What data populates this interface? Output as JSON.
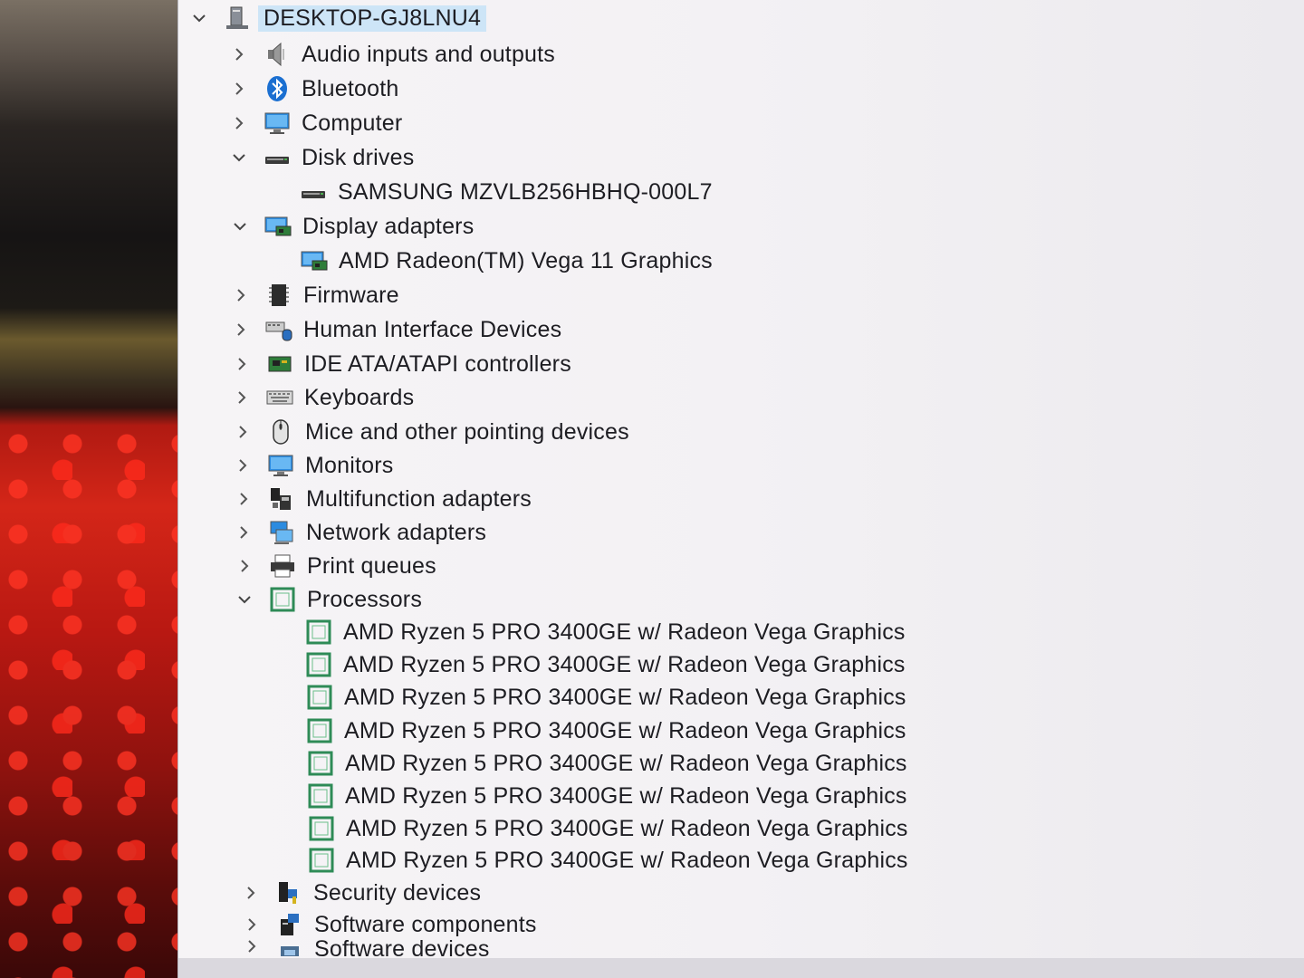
{
  "tree": {
    "root": {
      "label": "DESKTOP-GJ8LNU4",
      "icon": "computer-tower-icon"
    },
    "items": [
      {
        "label": "Audio inputs and outputs",
        "icon": "speaker-icon",
        "state": "collapsed"
      },
      {
        "label": "Bluetooth",
        "icon": "bluetooth-icon",
        "state": "collapsed"
      },
      {
        "label": "Computer",
        "icon": "monitor-icon",
        "state": "collapsed"
      },
      {
        "label": "Disk drives",
        "icon": "disk-drive-icon",
        "state": "expanded"
      },
      {
        "label": "SAMSUNG MZVLB256HBHQ-000L7",
        "icon": "disk-drive-icon",
        "state": "child"
      },
      {
        "label": "Display adapters",
        "icon": "display-adapter-icon",
        "state": "expanded"
      },
      {
        "label": "AMD Radeon(TM) Vega 11 Graphics",
        "icon": "display-adapter-icon",
        "state": "child"
      },
      {
        "label": "Firmware",
        "icon": "firmware-chip-icon",
        "state": "collapsed"
      },
      {
        "label": "Human Interface Devices",
        "icon": "hid-icon",
        "state": "collapsed"
      },
      {
        "label": "IDE ATA/ATAPI controllers",
        "icon": "ide-controller-icon",
        "state": "collapsed"
      },
      {
        "label": "Keyboards",
        "icon": "keyboard-icon",
        "state": "collapsed"
      },
      {
        "label": "Mice and other pointing devices",
        "icon": "mouse-icon",
        "state": "collapsed"
      },
      {
        "label": "Monitors",
        "icon": "monitor-icon",
        "state": "collapsed"
      },
      {
        "label": "Multifunction adapters",
        "icon": "multifunction-icon",
        "state": "collapsed"
      },
      {
        "label": "Network adapters",
        "icon": "network-adapter-icon",
        "state": "collapsed"
      },
      {
        "label": "Print queues",
        "icon": "printer-icon",
        "state": "collapsed"
      },
      {
        "label": "Processors",
        "icon": "processor-icon",
        "state": "expanded"
      },
      {
        "label": "AMD Ryzen 5 PRO 3400GE w/ Radeon Vega Graphics",
        "icon": "processor-icon",
        "state": "child"
      },
      {
        "label": "AMD Ryzen 5 PRO 3400GE w/ Radeon Vega Graphics",
        "icon": "processor-icon",
        "state": "child"
      },
      {
        "label": "AMD Ryzen 5 PRO 3400GE w/ Radeon Vega Graphics",
        "icon": "processor-icon",
        "state": "child"
      },
      {
        "label": "AMD Ryzen 5 PRO 3400GE w/ Radeon Vega Graphics",
        "icon": "processor-icon",
        "state": "child"
      },
      {
        "label": "AMD Ryzen 5 PRO 3400GE w/ Radeon Vega Graphics",
        "icon": "processor-icon",
        "state": "child"
      },
      {
        "label": "AMD Ryzen 5 PRO 3400GE w/ Radeon Vega Graphics",
        "icon": "processor-icon",
        "state": "child"
      },
      {
        "label": "AMD Ryzen 5 PRO 3400GE w/ Radeon Vega Graphics",
        "icon": "processor-icon",
        "state": "child"
      },
      {
        "label": "AMD Ryzen 5 PRO 3400GE w/ Radeon Vega Graphics",
        "icon": "processor-icon",
        "state": "child"
      },
      {
        "label": "Security devices",
        "icon": "security-device-icon",
        "state": "collapsed"
      },
      {
        "label": "Software components",
        "icon": "software-component-icon",
        "state": "collapsed"
      },
      {
        "label": "Software devices",
        "icon": "software-device-icon",
        "state": "collapsed"
      }
    ]
  },
  "colors": {
    "selection": "#cde5f7",
    "text": "#1d1d22",
    "processor_green": "#2e8b57",
    "accent_blue": "#1e7fd6"
  }
}
